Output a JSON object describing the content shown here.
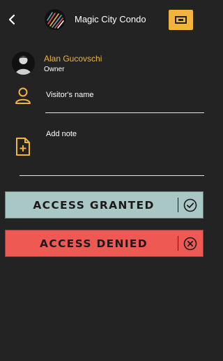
{
  "header": {
    "back_icon": "chevron-left-icon",
    "title": "Magic City Condo",
    "action_icon": "id-card-icon",
    "accent": "#f2b43c"
  },
  "owner": {
    "name": "Alan Gucovschi",
    "role": "Owner"
  },
  "form": {
    "visitor_placeholder": "Visitor's name",
    "visitor_icon": "person-icon",
    "note_placeholder": "Add note",
    "note_icon": "file-plus-icon"
  },
  "actions": {
    "granted_label": "ACCESS GRANTED",
    "granted_color": "#a9c7c4",
    "granted_icon": "check-circle-icon",
    "denied_label": "ACCESS DENIED",
    "denied_color": "#ee5a53",
    "denied_icon": "x-circle-icon"
  }
}
